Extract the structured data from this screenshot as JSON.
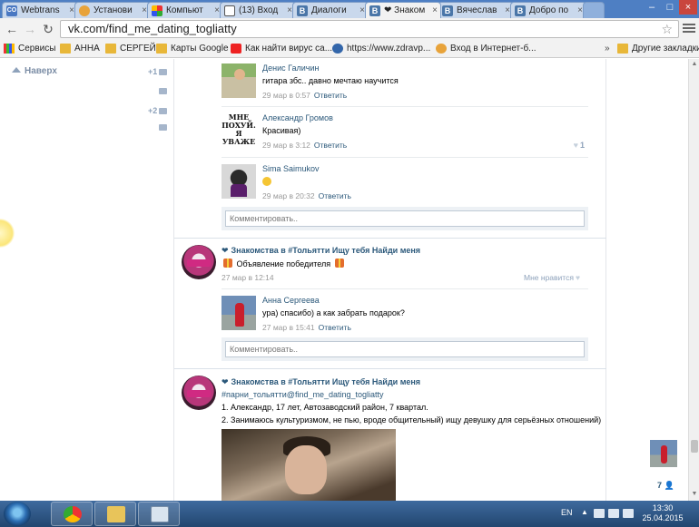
{
  "browser": {
    "tabs": [
      {
        "label": "Webtrans",
        "favicon_color": "#4a78c2",
        "favicon": "CO"
      },
      {
        "label": "Установи",
        "favicon_color": "#e8a33a",
        "favicon": ""
      },
      {
        "label": "Компьют",
        "favicon_color": "#3a9a3a",
        "favicon": ""
      },
      {
        "label": "(13) Вход",
        "favicon_color": "#555555",
        "favicon": ""
      },
      {
        "label": "Диалоги",
        "favicon_color": "#4a76a8",
        "favicon": "B"
      },
      {
        "label": "❤ Знаком",
        "favicon_color": "#4a76a8",
        "favicon": "B"
      },
      {
        "label": "Вячеслав",
        "favicon_color": "#4a76a8",
        "favicon": "B"
      },
      {
        "label": "Добро по",
        "favicon_color": "#4a76a8",
        "favicon": "B"
      }
    ],
    "url": "vk.com/find_me_dating_togliatty",
    "bookmarks": [
      {
        "label": "Сервисы",
        "icon": "apps"
      },
      {
        "label": "АННА",
        "icon": "folder"
      },
      {
        "label": "СЕРГЕЙ",
        "icon": "folder"
      },
      {
        "label": "Карты Google",
        "icon": "folder"
      },
      {
        "label": "Как найти вирус са...",
        "icon": "yt"
      },
      {
        "label": "https://www.zdravp...",
        "icon": "globe"
      },
      {
        "label": "Вход в Интернет-б...",
        "icon": "circ"
      }
    ],
    "bookmarks_other": "Другие закладки",
    "bookmarks_more": "»"
  },
  "sidebar": {
    "up_label": "Наверх",
    "count_1": "+1",
    "count_2": "+2"
  },
  "feed": {
    "comments_block_1": [
      {
        "author": "Денис Галичин",
        "text": "гитара збс.. давно мечтаю научится",
        "date": "29 мар в 0:57",
        "reply": "Ответить",
        "likes": ""
      },
      {
        "author": "Александр Громов",
        "text": "Красивая)",
        "date": "29 мар в 3:12",
        "reply": "Ответить",
        "likes": "1",
        "avatar_text": "МНЕ ПОХУЙ. Я УВАЖЕ"
      },
      {
        "author": "Sima Saimukov",
        "text": "",
        "date": "29 мар в 20:32",
        "reply": "Ответить",
        "likes": ""
      }
    ],
    "comment_placeholder": "Комментировать..",
    "post_1": {
      "author": "Знакомства в #Тольятти Ищу тебя Найди меня",
      "text": "Объявление победителя",
      "date": "27 мар в 12:14",
      "like_label": "Мне нравится"
    },
    "comments_block_2": [
      {
        "author": "Анна Сергеева",
        "text": "ура) спасибо) а как забрать подарок?",
        "date": "27 мар в 15:41",
        "reply": "Ответить"
      }
    ],
    "post_2": {
      "author": "Знакомства в #Тольятти Ищу тебя Найди меня",
      "tag": "#парни_тольятти@find_me_dating_togliatty",
      "line1": "1. Александр, 17 лет, Автозаводский район, 7 квартал.",
      "line2": "2. Занимаюсь культуризмом, не пью, вроде общительный) ищу девушку для серьёзных отношений)"
    }
  },
  "right": {
    "count": "7"
  },
  "taskbar": {
    "lang": "EN",
    "time": "13:30",
    "date": "25.04.2015"
  },
  "colors": {
    "vk_link": "#2b587a",
    "muted": "#999999",
    "tabstrip": "#4e7fc3"
  }
}
